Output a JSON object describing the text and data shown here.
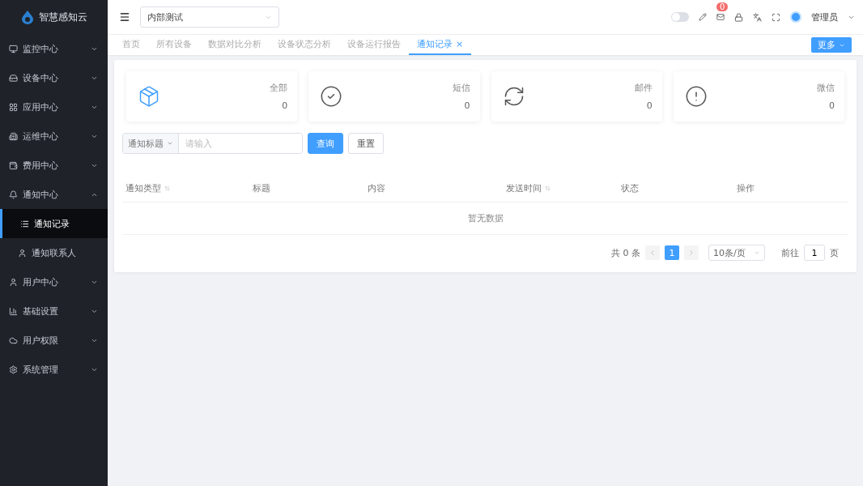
{
  "sidebar": {
    "logo": "智慧感知云",
    "items": [
      {
        "label": "监控中心",
        "expanded": false
      },
      {
        "label": "设备中心",
        "expanded": false
      },
      {
        "label": "应用中心",
        "expanded": false
      },
      {
        "label": "运维中心",
        "expanded": false
      },
      {
        "label": "费用中心",
        "expanded": false
      },
      {
        "label": "通知中心",
        "expanded": true,
        "children": [
          {
            "label": "通知记录",
            "selected": true
          },
          {
            "label": "通知联系人",
            "selected": false
          }
        ]
      },
      {
        "label": "用户中心",
        "expanded": false
      },
      {
        "label": "基础设置",
        "expanded": false
      },
      {
        "label": "用户权限",
        "expanded": false
      },
      {
        "label": "系统管理",
        "expanded": false
      }
    ]
  },
  "header": {
    "project": "内部测试",
    "theme_switch": {
      "on": false
    },
    "message_badge": "0",
    "user": "管理员"
  },
  "tabs": [
    {
      "label": "首页",
      "selected": false,
      "closable": false
    },
    {
      "label": "所有设备",
      "selected": false,
      "closable": false
    },
    {
      "label": "数据对比分析",
      "selected": false,
      "closable": false
    },
    {
      "label": "设备状态分析",
      "selected": false,
      "closable": false
    },
    {
      "label": "设备运行报告",
      "selected": false,
      "closable": false
    },
    {
      "label": "通知记录",
      "selected": true,
      "closable": true,
      "close": "×"
    }
  ],
  "more_button": "更多",
  "stats": [
    {
      "kind": "box",
      "label": "全部",
      "value": "0"
    },
    {
      "kind": "check",
      "label": "短信",
      "value": "0"
    },
    {
      "kind": "refresh",
      "label": "邮件",
      "value": "0"
    },
    {
      "kind": "alert",
      "label": "微信",
      "value": "0"
    }
  ],
  "search": {
    "field": "通知标题",
    "placeholder": "请输入",
    "query": "查询",
    "reset": "重置"
  },
  "table": {
    "columns": [
      {
        "label": "通知类型",
        "sortable": true
      },
      {
        "label": "标题",
        "sortable": false
      },
      {
        "label": "内容",
        "sortable": false
      },
      {
        "label": "发送时间",
        "sortable": true
      },
      {
        "label": "状态",
        "sortable": false
      },
      {
        "label": "操作",
        "sortable": false
      }
    ],
    "empty": "暂无数据"
  },
  "pagination": {
    "total": "共 0 条",
    "pages": [
      {
        "label": "1",
        "selected": true
      }
    ],
    "page_size": "10条/页",
    "goto_label": "前往",
    "goto_value": "1",
    "goto_suffix": "页"
  }
}
